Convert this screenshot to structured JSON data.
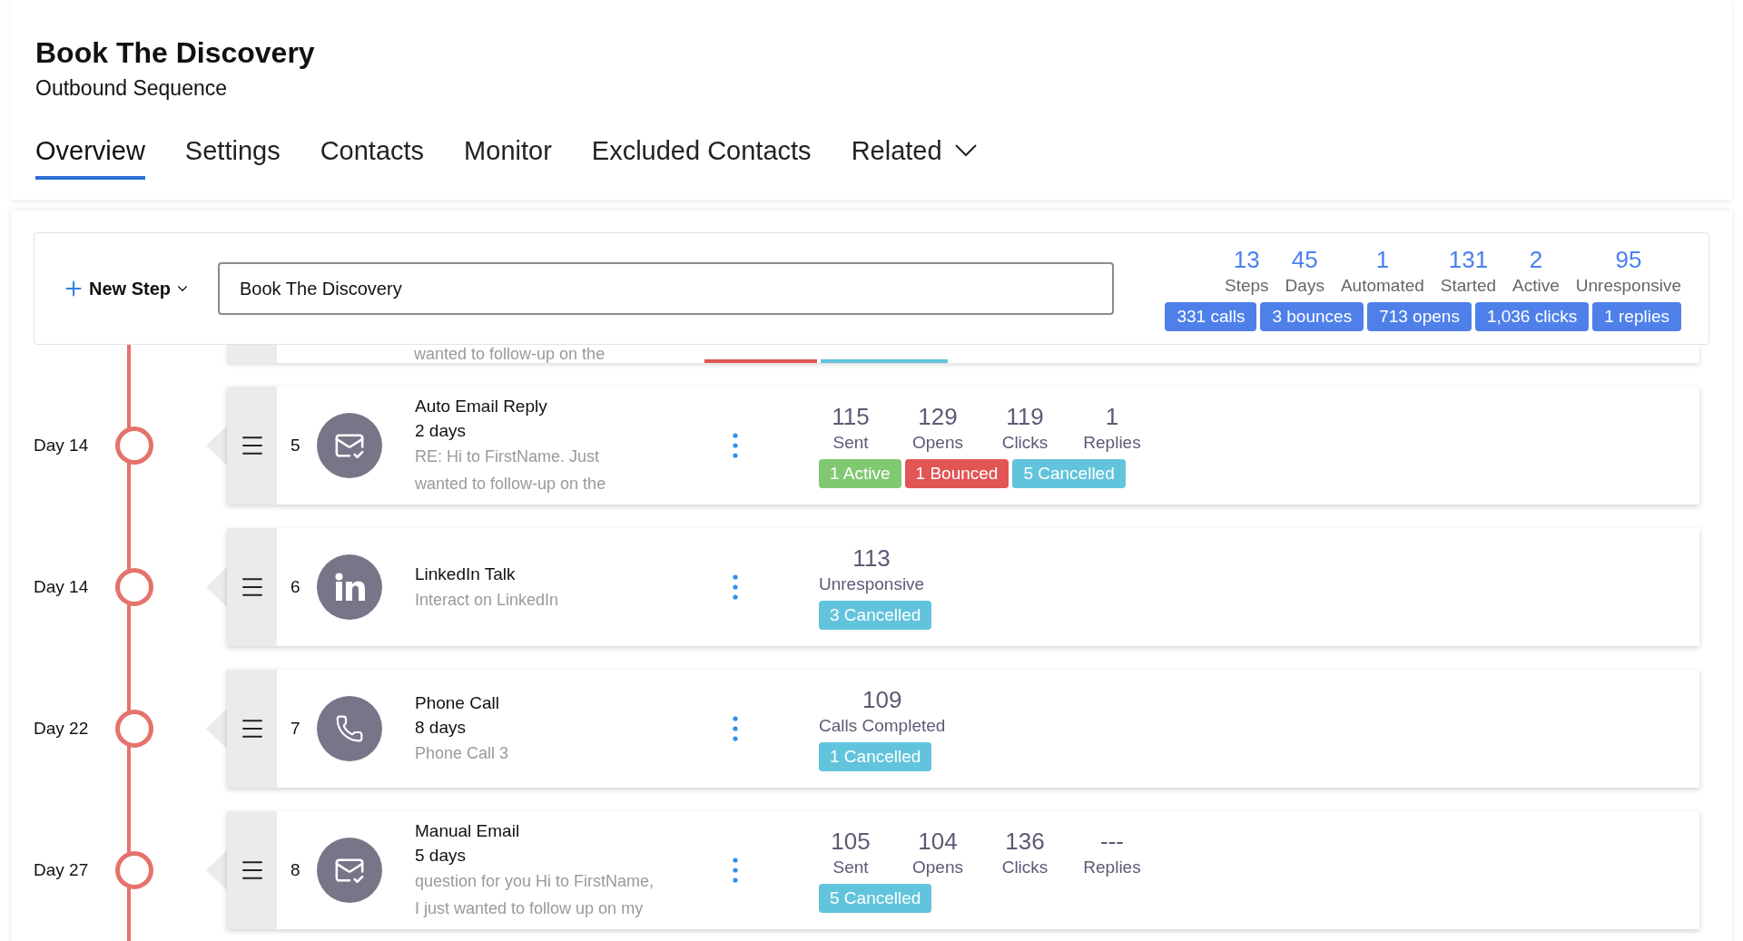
{
  "header": {
    "title": "Book The Discovery",
    "subtitle": "Outbound Sequence"
  },
  "tabs": [
    {
      "label": "Overview",
      "selected": true,
      "kind": "plain"
    },
    {
      "label": "Settings",
      "selected": false,
      "kind": "plain"
    },
    {
      "label": "Contacts",
      "selected": false,
      "kind": "plain"
    },
    {
      "label": "Monitor",
      "selected": false,
      "kind": "plain"
    },
    {
      "label": "Excluded Contacts",
      "selected": false,
      "kind": "plain"
    },
    {
      "label": "Related",
      "selected": false,
      "kind": "dropdown"
    }
  ],
  "toolbar": {
    "new_step": "New Step",
    "name_field": "Book The Discovery",
    "summary": [
      {
        "value": "13",
        "label": "Steps"
      },
      {
        "value": "45",
        "label": "Days"
      },
      {
        "value": "1",
        "label": "Automated"
      },
      {
        "value": "131",
        "label": "Started"
      },
      {
        "value": "2",
        "label": "Active"
      },
      {
        "value": "95",
        "label": "Unresponsive"
      }
    ],
    "totals": [
      "331 calls",
      "3 bounces",
      "713 opens",
      "1,036 clicks",
      "1 replies"
    ]
  },
  "clipped_step": {
    "description": "wanted to follow-up on the"
  },
  "steps": [
    {
      "day": "Day 14",
      "number": "5",
      "kind": "email",
      "title": "Auto Email Reply",
      "duration": "2 days",
      "description": [
        "RE: Hi to FirstName. Just",
        "wanted to follow-up on the"
      ],
      "stats": [
        {
          "value": "115",
          "label": "Sent"
        },
        {
          "value": "129",
          "label": "Opens"
        },
        {
          "value": "119",
          "label": "Clicks"
        },
        {
          "value": "1",
          "label": "Replies"
        }
      ],
      "badges": [
        {
          "label": "1 Active",
          "color": "#80c972"
        },
        {
          "label": "1 Bounced",
          "color": "#e25555"
        },
        {
          "label": "5 Cancelled",
          "color": "#62c4dc"
        }
      ]
    },
    {
      "day": "Day 14",
      "number": "6",
      "kind": "linkedin",
      "title": "LinkedIn Talk",
      "description": [
        "Interact on LinkedIn"
      ],
      "stats": [
        {
          "value": "113",
          "label": "Unresponsive"
        }
      ],
      "badges": [
        {
          "label": "3 Cancelled",
          "color": "#62c4dc"
        }
      ]
    },
    {
      "day": "Day 22",
      "number": "7",
      "kind": "phone",
      "title": "Phone Call",
      "duration": "8 days",
      "description": [
        "Phone Call 3"
      ],
      "stats": [
        {
          "value": "109",
          "label": "Calls Completed"
        }
      ],
      "badges": [
        {
          "label": "1 Cancelled",
          "color": "#62c4dc"
        }
      ]
    },
    {
      "day": "Day 27",
      "number": "8",
      "kind": "email",
      "title": "Manual Email",
      "duration": "5 days",
      "description": [
        "question for you Hi to FirstName,",
        "I just wanted to follow up on my"
      ],
      "stats": [
        {
          "value": "105",
          "label": "Sent"
        },
        {
          "value": "104",
          "label": "Opens"
        },
        {
          "value": "136",
          "label": "Clicks"
        },
        {
          "value": "---",
          "label": "Replies"
        }
      ],
      "badges": [
        {
          "label": "5 Cancelled",
          "color": "#62c4dc"
        }
      ]
    }
  ]
}
